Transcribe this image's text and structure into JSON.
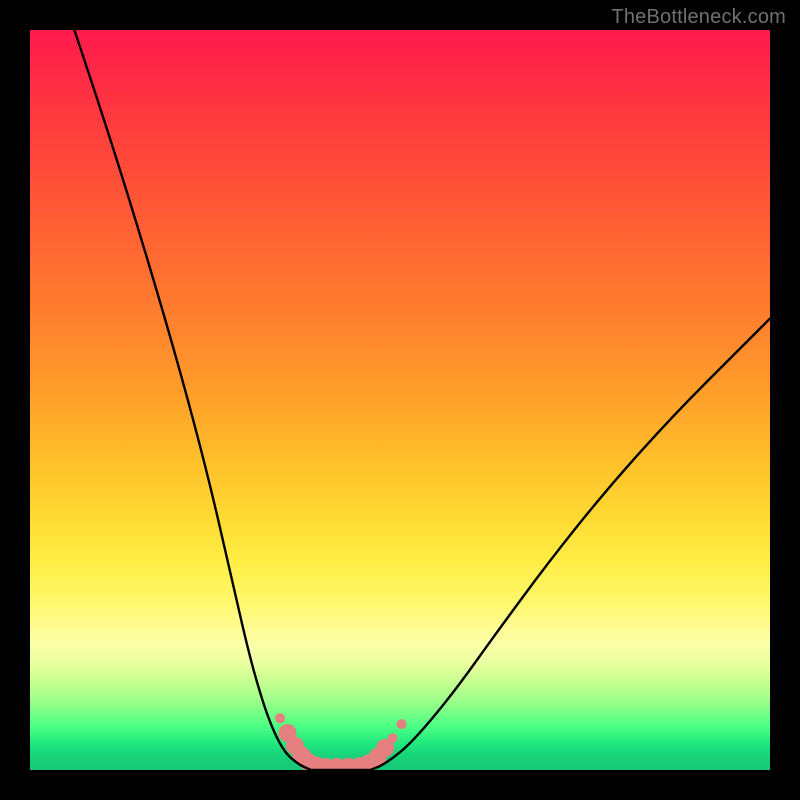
{
  "watermark": "TheBottleneck.com",
  "chart_data": {
    "type": "line",
    "title": "",
    "xlabel": "",
    "ylabel": "",
    "xlim": [
      0,
      100
    ],
    "ylim": [
      0,
      100
    ],
    "series": [
      {
        "name": "left-curve",
        "x": [
          6,
          10,
          15,
          20,
          24,
          27,
          29.5,
          31.5,
          33,
          34.5,
          36,
          37,
          38
        ],
        "values": [
          100,
          88,
          72,
          55,
          40,
          27,
          16,
          9,
          5,
          2.3,
          1,
          0.4,
          0
        ]
      },
      {
        "name": "bottom-curve",
        "x": [
          38,
          40,
          42,
          44,
          46
        ],
        "values": [
          0,
          0,
          0,
          0,
          0
        ]
      },
      {
        "name": "right-curve",
        "x": [
          46,
          47.5,
          49,
          51,
          54,
          58,
          63,
          70,
          78,
          87,
          96,
          100
        ],
        "values": [
          0,
          0.6,
          1.6,
          3.2,
          6.5,
          11.5,
          18.5,
          28,
          38,
          48,
          57,
          61
        ]
      }
    ],
    "markers": {
      "name": "highlight-beads",
      "color": "#e57f80",
      "radius_small": 5,
      "radius_large": 9,
      "points": [
        {
          "x": 33.8,
          "y": 7.0,
          "r": "small"
        },
        {
          "x": 34.8,
          "y": 5.0,
          "r": "large"
        },
        {
          "x": 35.8,
          "y": 3.3,
          "r": "large"
        },
        {
          "x": 36.7,
          "y": 2.0,
          "r": "large"
        },
        {
          "x": 37.6,
          "y": 1.1,
          "r": "large"
        },
        {
          "x": 38.7,
          "y": 0.6,
          "r": "large"
        },
        {
          "x": 40.0,
          "y": 0.4,
          "r": "large"
        },
        {
          "x": 41.5,
          "y": 0.4,
          "r": "large"
        },
        {
          "x": 43.0,
          "y": 0.4,
          "r": "large"
        },
        {
          "x": 44.5,
          "y": 0.5,
          "r": "large"
        },
        {
          "x": 45.8,
          "y": 0.9,
          "r": "large"
        },
        {
          "x": 47.0,
          "y": 1.8,
          "r": "large"
        },
        {
          "x": 48.0,
          "y": 3.0,
          "r": "large"
        },
        {
          "x": 49.0,
          "y": 4.3,
          "r": "small"
        },
        {
          "x": 50.2,
          "y": 6.2,
          "r": "small"
        }
      ]
    },
    "gradient_stops": [
      {
        "pos": 0,
        "color": "#ff1a4d"
      },
      {
        "pos": 0.5,
        "color": "#ffbf2a"
      },
      {
        "pos": 0.8,
        "color": "#fffb8f"
      },
      {
        "pos": 1.0,
        "color": "#16c776"
      }
    ]
  }
}
